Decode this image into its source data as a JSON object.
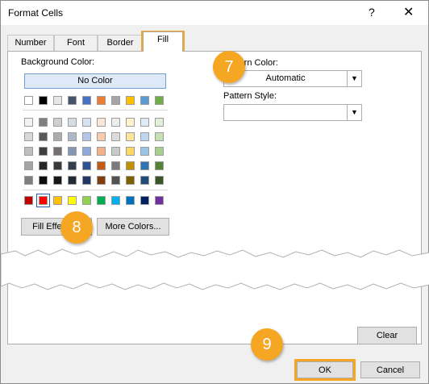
{
  "window": {
    "title": "Format Cells",
    "help_glyph": "?",
    "close_glyph": "✕"
  },
  "tabs": [
    {
      "label": "Number"
    },
    {
      "label": "Font"
    },
    {
      "label": "Border"
    },
    {
      "label": "Fill"
    }
  ],
  "background_color": {
    "label": "Background Color:",
    "no_color_label": "No Color",
    "theme_top_row": [
      "#ffffff",
      "#000000",
      "#e7e6e6",
      "#44546a",
      "#4472c4",
      "#ed7d31",
      "#a5a5a5",
      "#ffc000",
      "#5b9bd5",
      "#70ad47"
    ],
    "theme_tints": [
      [
        "#f2f2f2",
        "#7f7f7f",
        "#d0cece",
        "#d6dce4",
        "#d9e2f3",
        "#fbe5d5",
        "#ededed",
        "#fff2cc",
        "#deebf6",
        "#e2efd9"
      ],
      [
        "#d8d8d8",
        "#595959",
        "#aeabab",
        "#adb9ca",
        "#b4c6e7",
        "#f7cbac",
        "#dbdbdb",
        "#fee599",
        "#bdd7ee",
        "#c5e0b3"
      ],
      [
        "#bfbfbf",
        "#3f3f3f",
        "#757070",
        "#8496b0",
        "#8eaadb",
        "#f4b183",
        "#c9c9c9",
        "#ffd965",
        "#9cc3e5",
        "#a8d08d"
      ],
      [
        "#a5a5a5",
        "#262626",
        "#3a3838",
        "#323f4f",
        "#2f5496",
        "#c55a11",
        "#7b7b7b",
        "#bf9000",
        "#2e75b5",
        "#538135"
      ],
      [
        "#7f7f7f",
        "#0c0c0c",
        "#171616",
        "#222a35",
        "#1f3864",
        "#833c0b",
        "#525252",
        "#7f6000",
        "#1e4d78",
        "#375623"
      ]
    ],
    "standard": [
      "#c00000",
      "#ff0000",
      "#ffc000",
      "#ffff00",
      "#92d050",
      "#00b050",
      "#00b0f0",
      "#0070c0",
      "#002060",
      "#7030a0"
    ],
    "selected_standard_index": 1
  },
  "buttons": {
    "fill_effects": "Fill Effects...",
    "more_colors": "More Colors...",
    "clear": "Clear",
    "ok": "OK",
    "cancel": "Cancel"
  },
  "pattern": {
    "color_label": "Pattern Color:",
    "color_value": "Automatic",
    "style_label": "Pattern Style:",
    "style_value": ""
  },
  "callouts": [
    "7",
    "8",
    "9"
  ],
  "colors": {
    "callout": "#f5a623",
    "selection": "#6f9ed1"
  }
}
